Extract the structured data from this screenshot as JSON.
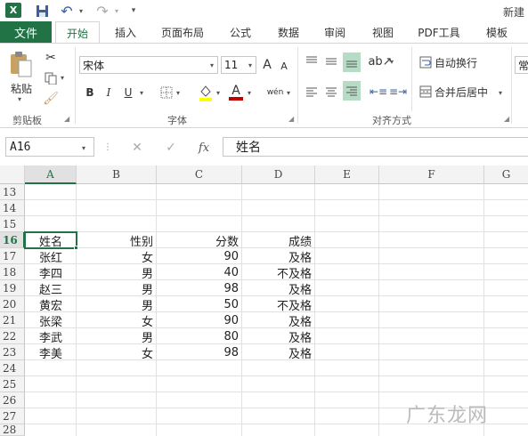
{
  "app": {
    "logo_text": "X",
    "doc_title": "新建"
  },
  "quick_access": {
    "save_icon": "save-icon",
    "undo_icon": "undo-icon",
    "redo_icon": "redo-icon",
    "customize_icon": "customize-icon"
  },
  "tabs": [
    {
      "label": "文件"
    },
    {
      "label": "开始"
    },
    {
      "label": "插入"
    },
    {
      "label": "页面布局"
    },
    {
      "label": "公式"
    },
    {
      "label": "数据"
    },
    {
      "label": "审阅"
    },
    {
      "label": "视图"
    },
    {
      "label": "PDF工具"
    },
    {
      "label": "模板"
    }
  ],
  "ribbon": {
    "clipboard": {
      "paste_label": "粘贴",
      "group_label": "剪贴板"
    },
    "font": {
      "font_name": "宋体",
      "font_size": "11",
      "bold": "B",
      "italic": "I",
      "underline": "U",
      "grow": "A",
      "shrink": "A",
      "phonetic": "wén",
      "group_label": "字体",
      "fill_color": "#ffff00",
      "font_color": "#c00000"
    },
    "alignment": {
      "wrap_text": "自动换行",
      "merge_center": "合并后居中",
      "group_label": "对齐方式"
    },
    "number_partial": "常"
  },
  "formula_bar": {
    "name_box": "A16",
    "fx_label": "fx",
    "value": "姓名"
  },
  "columns": [
    "A",
    "B",
    "C",
    "D",
    "E",
    "F",
    "G"
  ],
  "rows": [
    "13",
    "14",
    "15",
    "16",
    "17",
    "18",
    "19",
    "20",
    "21",
    "22",
    "23",
    "24",
    "25",
    "26",
    "27",
    "28"
  ],
  "table": {
    "header": {
      "name": "姓名",
      "gender": "性别",
      "score": "分数",
      "grade": "成绩"
    },
    "records": [
      {
        "name": "张红",
        "gender": "女",
        "score": "90",
        "grade": "及格"
      },
      {
        "name": "李四",
        "gender": "男",
        "score": "40",
        "grade": "不及格"
      },
      {
        "name": "赵三",
        "gender": "男",
        "score": "98",
        "grade": "及格"
      },
      {
        "name": "黄宏",
        "gender": "男",
        "score": "50",
        "grade": "不及格"
      },
      {
        "name": "张梁",
        "gender": "女",
        "score": "90",
        "grade": "及格"
      },
      {
        "name": "李武",
        "gender": "男",
        "score": "80",
        "grade": "及格"
      },
      {
        "name": "李美",
        "gender": "女",
        "score": "98",
        "grade": "及格"
      }
    ]
  },
  "watermark": "广东龙网",
  "colors": {
    "accent": "#217346",
    "selection_fill": "#b7dcc5"
  }
}
